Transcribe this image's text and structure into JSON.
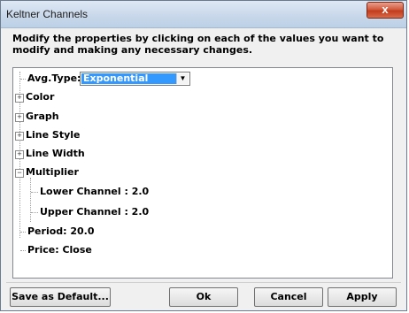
{
  "window": {
    "title": "Keltner Channels",
    "close_symbol": "x"
  },
  "instruction": "Modify the properties by clicking on each of the values you want to modify and making any necessary changes.",
  "tree": {
    "avg_type": {
      "label": "Avg.Type:",
      "value": "Exponential"
    },
    "items": {
      "color": "Color",
      "graph": "Graph",
      "line_style": "Line Style",
      "line_width": "Line Width",
      "multiplier": "Multiplier",
      "lower_channel": "Lower Channel : 2.0",
      "upper_channel": "Upper Channel : 2.0",
      "period": "Period: 20.0",
      "price": "Price: Close"
    },
    "expanded_symbol": "−",
    "collapsed_symbol": "+"
  },
  "buttons": {
    "save_default": "Save as Default...",
    "ok": "Ok",
    "cancel": "Cancel",
    "apply": "Apply"
  },
  "colors": {
    "selection": "#3399ff",
    "close_button": "#c23b1c"
  },
  "icons": {
    "close": "close-icon",
    "dropdown": "chevron-down-icon"
  }
}
